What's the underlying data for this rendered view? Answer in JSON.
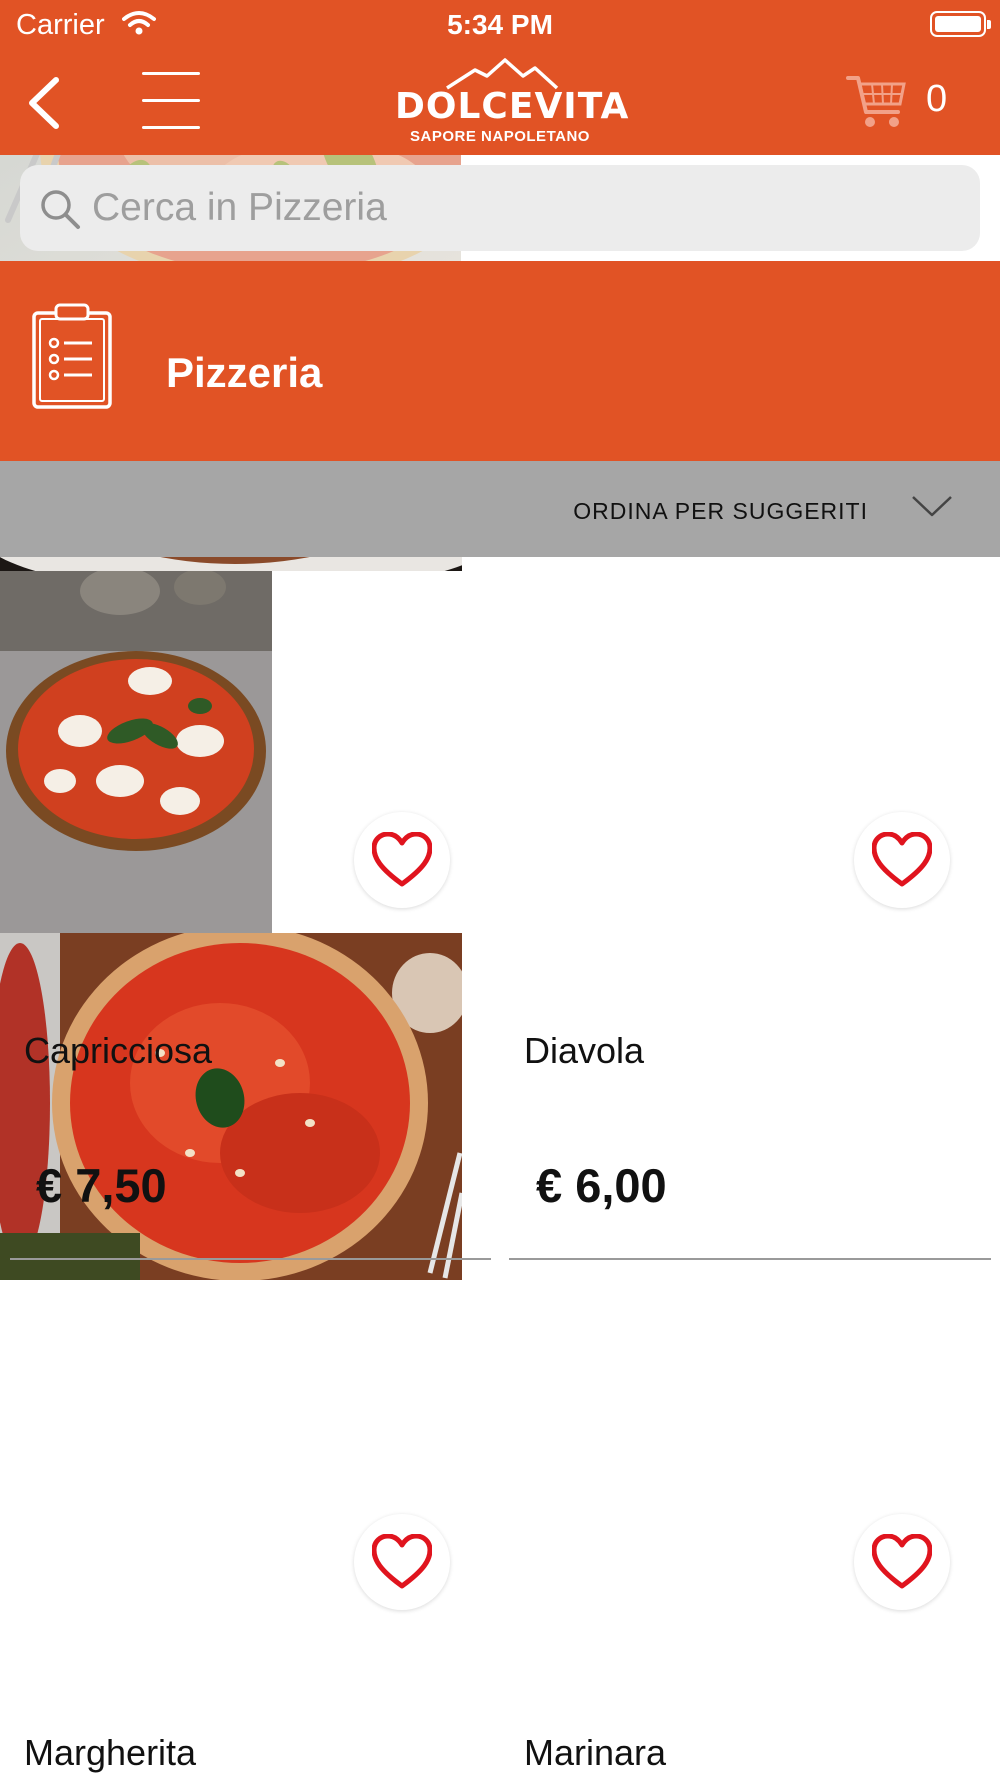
{
  "status_bar": {
    "carrier": "Carrier",
    "time": "5:34 PM"
  },
  "header": {
    "brand": "DOLCEVITA",
    "tagline": "SAPORE NAPOLETANO",
    "cart_count": "0",
    "accent_color": "#e15325"
  },
  "search": {
    "placeholder": "Cerca in Pizzeria",
    "value": ""
  },
  "category": {
    "title": "Pizzeria",
    "icon": "clipboard-list-icon"
  },
  "sort": {
    "label": "ORDINA PER SUGGERITI",
    "icon": "chevron-down-icon"
  },
  "products": [
    {
      "name": "Capricciosa",
      "price": "€ 7,50"
    },
    {
      "name": "Diavola",
      "price": "€ 6,00"
    },
    {
      "name": "Margherita",
      "price": ""
    },
    {
      "name": "Marinara",
      "price": ""
    }
  ]
}
